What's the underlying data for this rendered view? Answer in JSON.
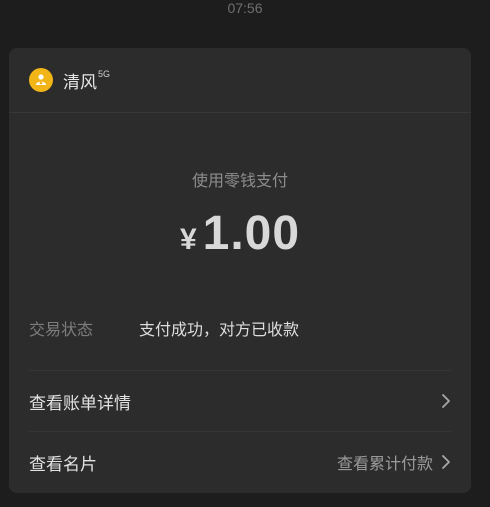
{
  "timestamp": "07:56",
  "merchant": {
    "name": "清风",
    "tag": "5G",
    "icon": "merchant-logo-icon"
  },
  "payment": {
    "method": "使用零钱支付",
    "currency": "¥",
    "amount": "1.00"
  },
  "status": {
    "label": "交易状态",
    "value": "支付成功，对方已收款"
  },
  "actions": {
    "details_label": "查看账单详情",
    "card_label": "查看名片",
    "card_extra": "查看累计付款"
  },
  "colors": {
    "background": "#1d1d1d",
    "card": "#2c2c2c",
    "logo": "#f2b517"
  }
}
